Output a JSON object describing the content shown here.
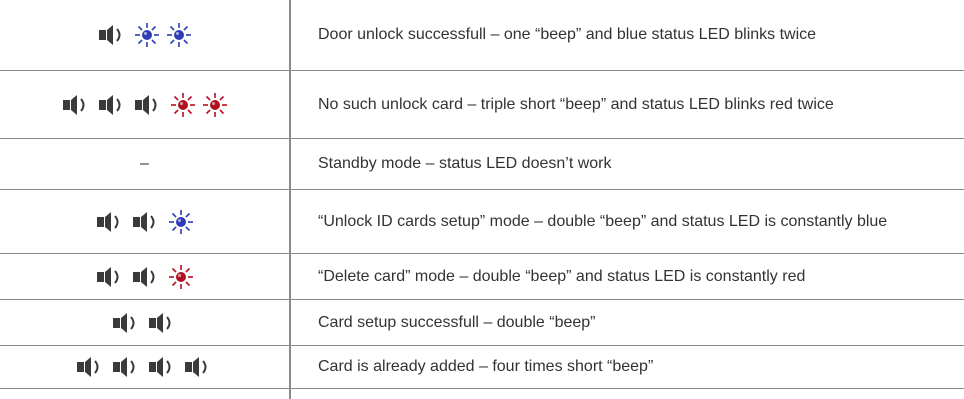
{
  "rows": [
    {
      "desc": "Door unlock successfull – one “beep” and blue status LED blinks twice",
      "beeps": 1,
      "leds": [
        "blue",
        "blue"
      ]
    },
    {
      "desc": "No such unlock card – triple short “beep” and  status LED blinks red twice",
      "beeps": 3,
      "leds": [
        "red",
        "red"
      ]
    },
    {
      "desc": "Standby mode – status LED doesn’t work",
      "beeps": 0,
      "leds": [],
      "placeholder": "–"
    },
    {
      "desc": "“Unlock ID cards setup” mode – double “beep” and status LED is constantly blue",
      "beeps": 2,
      "leds": [
        "blue"
      ]
    },
    {
      "desc": "“Delete card” mode – double “beep” and status LED is constantly red",
      "beeps": 2,
      "leds": [
        "red"
      ]
    },
    {
      "desc": "Card setup successfull – double “beep”",
      "beeps": 2,
      "leds": []
    },
    {
      "desc": "Card is already added – four times short “beep”",
      "beeps": 4,
      "leds": []
    }
  ],
  "colors": {
    "blue": "#2d3bb8",
    "red": "#b01020",
    "speaker": "#3a3a3a",
    "rule": "#8a8a8a"
  },
  "icons": {
    "beep": "speaker-icon",
    "led": "status-led-icon"
  }
}
